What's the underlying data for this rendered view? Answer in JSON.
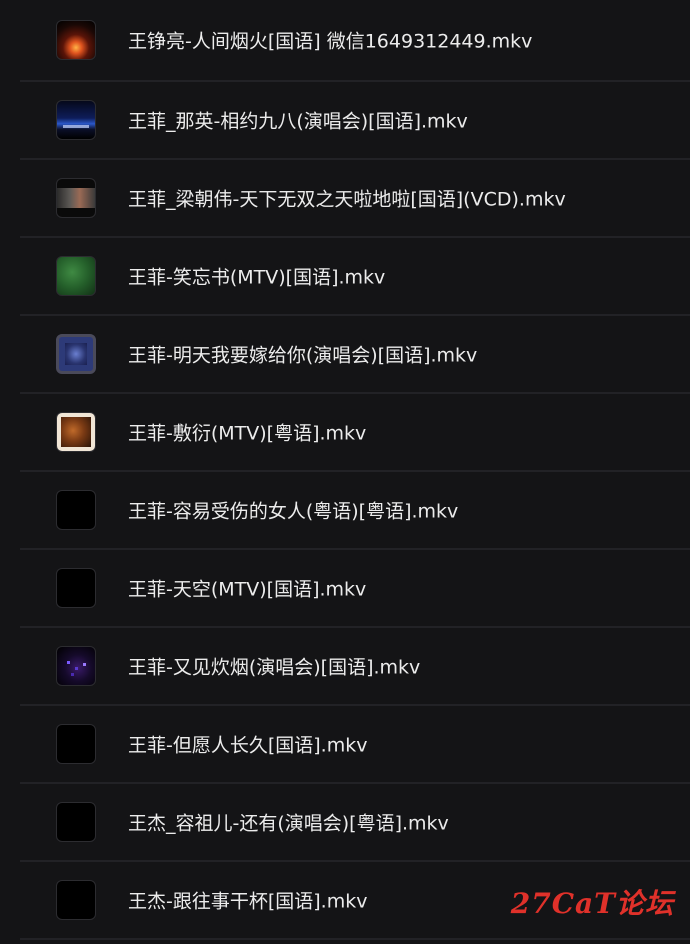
{
  "files": [
    {
      "name": "王铮亮-人间烟火[国语] 微信1649312449.mkv",
      "thumbnail": "fire-thumbnail"
    },
    {
      "name": "王菲_那英-相约九八(演唱会)[国语].mkv",
      "thumbnail": "stage-thumbnail"
    },
    {
      "name": "王菲_梁朝伟-天下无双之天啦地啦[国语](VCD).mkv",
      "thumbnail": "vcd-thumbnail"
    },
    {
      "name": "王菲-笑忘书(MTV)[国语].mkv",
      "thumbnail": "green-thumbnail"
    },
    {
      "name": "王菲-明天我要嫁给你(演唱会)[国语].mkv",
      "thumbnail": "blue-thumbnail"
    },
    {
      "name": "王菲-敷衍(MTV)[粤语].mkv",
      "thumbnail": "brown-thumbnail"
    },
    {
      "name": "王菲-容易受伤的女人(粤语)[粤语].mkv",
      "thumbnail": "black-thumbnail"
    },
    {
      "name": "王菲-天空(MTV)[国语].mkv",
      "thumbnail": "black-thumbnail"
    },
    {
      "name": "王菲-又见炊烟(演唱会)[国语].mkv",
      "thumbnail": "purple-thumbnail"
    },
    {
      "name": "王菲-但愿人长久[国语].mkv",
      "thumbnail": "black-thumbnail"
    },
    {
      "name": "王杰_容祖儿-还有(演唱会)[粤语].mkv",
      "thumbnail": "black-thumbnail"
    },
    {
      "name": "王杰-跟往事干杯[国语].mkv",
      "thumbnail": "black-thumbnail"
    }
  ],
  "watermark": "27CaT论坛",
  "colors": {
    "background": "#141416",
    "divider": "#222226",
    "text": "#ececec",
    "watermark": "#e0312a"
  }
}
